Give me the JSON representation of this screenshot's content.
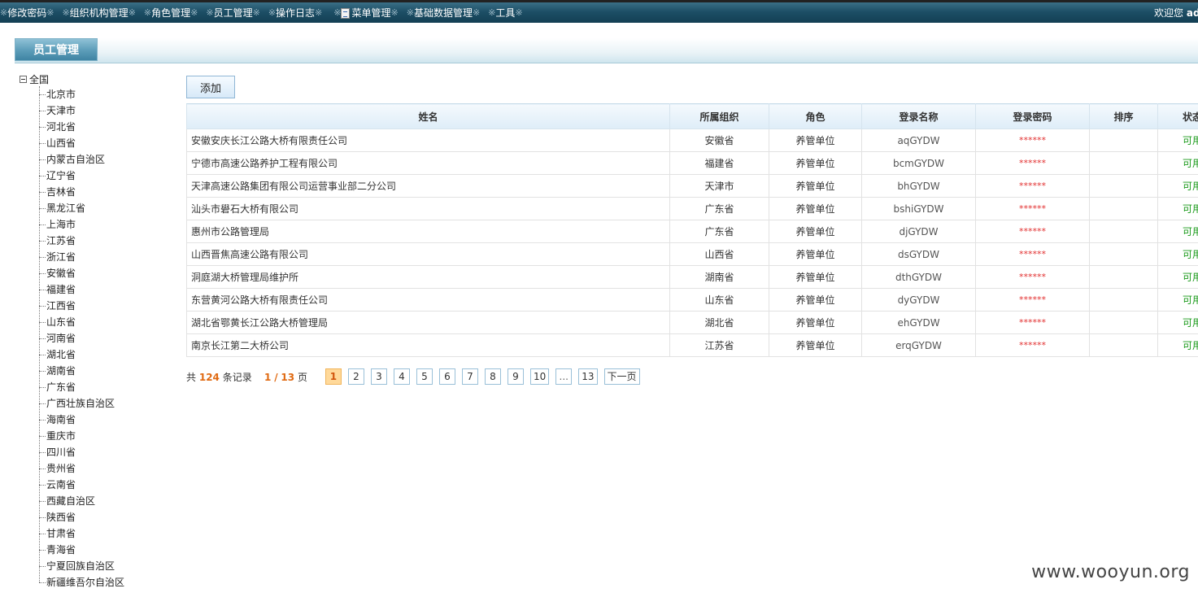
{
  "topbar": {
    "menu": [
      {
        "label": "修改密码",
        "icon": null
      },
      {
        "label": "组织机构管理",
        "icon": null
      },
      {
        "label": "角色管理",
        "icon": null
      },
      {
        "label": "员工管理",
        "icon": null
      },
      {
        "label": "操作日志",
        "icon": null
      },
      {
        "label": "菜单管理",
        "icon": "document-icon"
      },
      {
        "label": "基础数据管理",
        "icon": null
      },
      {
        "label": "工具",
        "icon": null
      }
    ],
    "separator": "※",
    "welcome_text": "欢迎您",
    "welcome_user": "ad"
  },
  "section": {
    "title": "员工管理"
  },
  "tree": {
    "root": "全国",
    "items": [
      "北京市",
      "天津市",
      "河北省",
      "山西省",
      "内蒙古自治区",
      "辽宁省",
      "吉林省",
      "黑龙江省",
      "上海市",
      "江苏省",
      "浙江省",
      "安徽省",
      "福建省",
      "江西省",
      "山东省",
      "河南省",
      "湖北省",
      "湖南省",
      "广东省",
      "广西壮族自治区",
      "海南省",
      "重庆市",
      "四川省",
      "贵州省",
      "云南省",
      "西藏自治区",
      "陕西省",
      "甘肃省",
      "青海省",
      "宁夏回族自治区",
      "新疆维吾尔自治区"
    ]
  },
  "toolbar": {
    "add_label": "添加"
  },
  "grid": {
    "columns": [
      "姓名",
      "所属组织",
      "角色",
      "登录名称",
      "登录密码",
      "排序",
      "状态"
    ],
    "rows": [
      {
        "name": "安徽安庆长江公路大桥有限责任公司",
        "org": "安徽省",
        "role": "养管单位",
        "login": "aqGYDW",
        "pwd": "******",
        "sort": "",
        "status": "可用"
      },
      {
        "name": "宁德市高速公路养护工程有限公司",
        "org": "福建省",
        "role": "养管单位",
        "login": "bcmGYDW",
        "pwd": "******",
        "sort": "",
        "status": "可用"
      },
      {
        "name": "天津高速公路集团有限公司运营事业部二分公司",
        "org": "天津市",
        "role": "养管单位",
        "login": "bhGYDW",
        "pwd": "******",
        "sort": "",
        "status": "可用"
      },
      {
        "name": "汕头市礐石大桥有限公司",
        "org": "广东省",
        "role": "养管单位",
        "login": "bshiGYDW",
        "pwd": "******",
        "sort": "",
        "status": "可用"
      },
      {
        "name": "惠州市公路管理局",
        "org": "广东省",
        "role": "养管单位",
        "login": "djGYDW",
        "pwd": "******",
        "sort": "",
        "status": "可用"
      },
      {
        "name": "山西晋焦高速公路有限公司",
        "org": "山西省",
        "role": "养管单位",
        "login": "dsGYDW",
        "pwd": "******",
        "sort": "",
        "status": "可用"
      },
      {
        "name": "洞庭湖大桥管理局维护所",
        "org": "湖南省",
        "role": "养管单位",
        "login": "dthGYDW",
        "pwd": "******",
        "sort": "",
        "status": "可用"
      },
      {
        "name": "东营黄河公路大桥有限责任公司",
        "org": "山东省",
        "role": "养管单位",
        "login": "dyGYDW",
        "pwd": "******",
        "sort": "",
        "status": "可用"
      },
      {
        "name": "湖北省鄂黄长江公路大桥管理局",
        "org": "湖北省",
        "role": "养管单位",
        "login": "ehGYDW",
        "pwd": "******",
        "sort": "",
        "status": "可用"
      },
      {
        "name": "南京长江第二大桥公司",
        "org": "江苏省",
        "role": "养管单位",
        "login": "erqGYDW",
        "pwd": "******",
        "sort": "",
        "status": "可用"
      }
    ]
  },
  "pager": {
    "prefix": "共",
    "total": "124",
    "records_label": "条记录",
    "current": "1",
    "slash": "/",
    "total_pages": "13",
    "pages_label": "页",
    "pages": [
      "1",
      "2",
      "3",
      "4",
      "5",
      "6",
      "7",
      "8",
      "9",
      "10",
      "...",
      "13"
    ],
    "current_index": 0,
    "next_label": "下一页"
  },
  "watermark": "www.wooyun.org"
}
